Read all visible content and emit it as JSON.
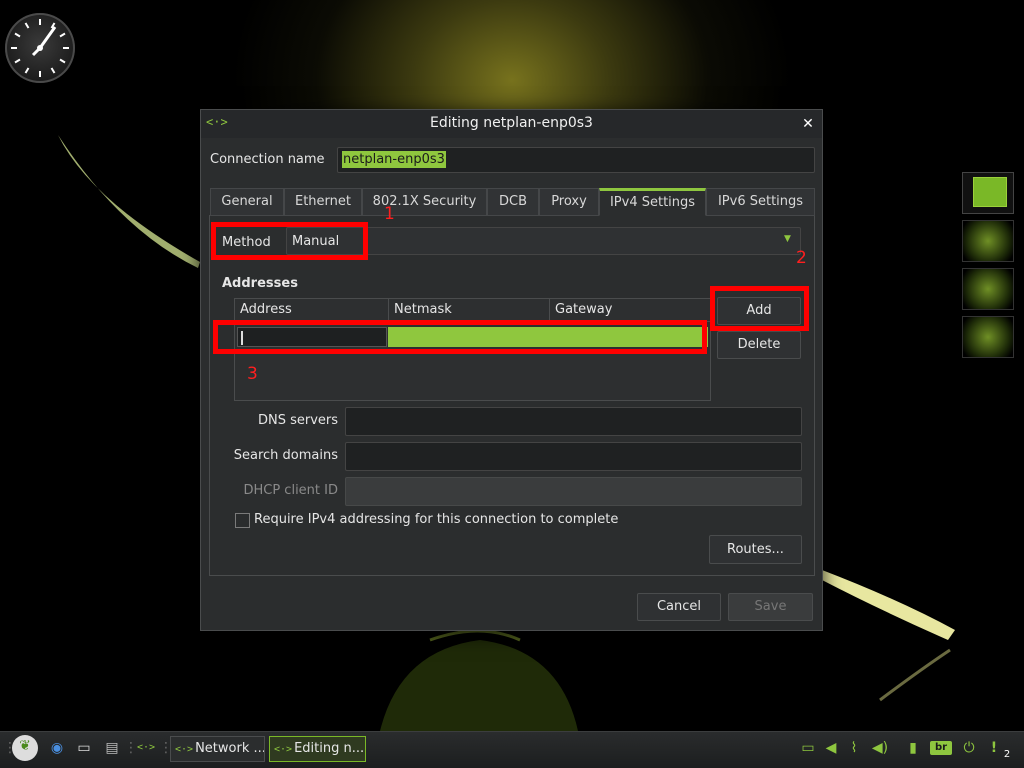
{
  "dialog": {
    "title": "Editing netplan-enp0s3",
    "icon": "network-connection-icon",
    "icon_glyph": "<·>",
    "close_glyph": "✕"
  },
  "connection": {
    "label": "Connection name",
    "value": "netplan-enp0s3"
  },
  "tabs": [
    {
      "label": "General"
    },
    {
      "label": "Ethernet"
    },
    {
      "label": "802.1X Security"
    },
    {
      "label": "DCB"
    },
    {
      "label": "Proxy"
    },
    {
      "label": "IPv4 Settings",
      "active": true
    },
    {
      "label": "IPv6 Settings"
    }
  ],
  "ipv4": {
    "method_label": "Method",
    "method_value": "Manual",
    "addresses_title": "Addresses",
    "columns": [
      "Address",
      "Netmask",
      "Gateway"
    ],
    "add_label": "Add",
    "delete_label": "Delete",
    "dns_label": "DNS servers",
    "search_label": "Search domains",
    "dhcp_label": "DHCP client ID",
    "require_label": "Require IPv4 addressing for this connection to complete",
    "require_checked": false,
    "routes_label": "Routes..."
  },
  "footer": {
    "cancel_label": "Cancel",
    "save_label": "Save"
  },
  "annotations": [
    "1",
    "2",
    "3"
  ],
  "taskbar": {
    "tasks": [
      {
        "label": "Network ..."
      },
      {
        "label": "Editing n...",
        "active": true
      }
    ],
    "keyboard_layout": "br",
    "notification_count": "2"
  },
  "colors": {
    "accent": "#8ec63f",
    "annotation": "#ff0000",
    "dialog_bg": "#2b2d2e"
  }
}
